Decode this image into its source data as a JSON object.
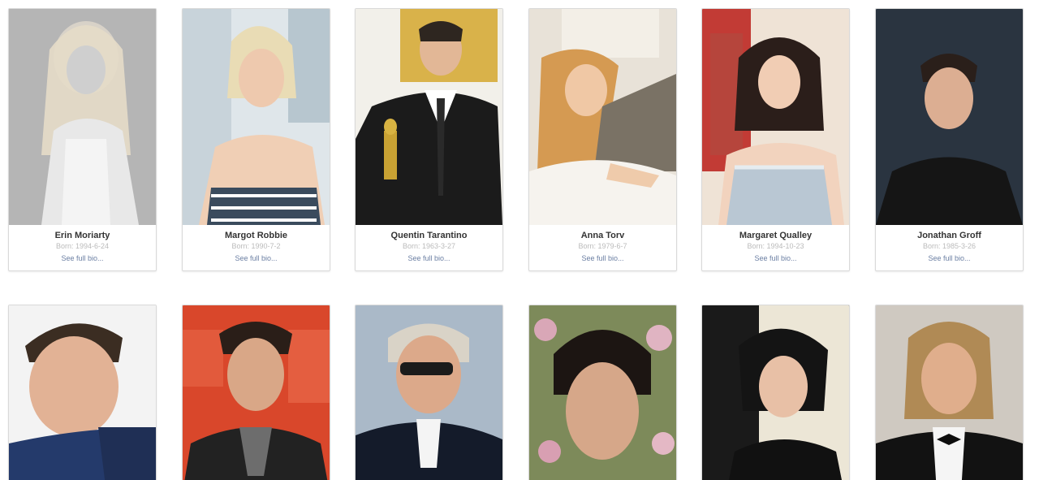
{
  "cards": [
    {
      "name": "Erin Moriarty",
      "born": "Born: 1994-6-24",
      "bio_link": "See full bio...",
      "photo": "portrait-bw-blonde-woman"
    },
    {
      "name": "Margot Robbie",
      "born": "Born: 1990-7-2",
      "bio_link": "See full bio...",
      "photo": "portrait-blonde-woman-striped-top"
    },
    {
      "name": "Quentin Tarantino",
      "born": "Born: 1963-3-27",
      "bio_link": "See full bio...",
      "photo": "portrait-man-tuxedo-oscar"
    },
    {
      "name": "Anna Torv",
      "born": "Born: 1979-6-7",
      "bio_link": "See full bio...",
      "photo": "portrait-woman-reclining-fur"
    },
    {
      "name": "Margaret Qualley",
      "born": "Born: 1994-10-23",
      "bio_link": "See full bio...",
      "photo": "portrait-brunette-woman-sequin-dress"
    },
    {
      "name": "Jonathan Groff",
      "born": "Born: 1985-3-26",
      "bio_link": "See full bio...",
      "photo": "portrait-man-dark-sweater"
    },
    {
      "photo": "portrait-man-blue-suit"
    },
    {
      "photo": "portrait-man-sundance-backdrop"
    },
    {
      "photo": "portrait-man-sunglasses-tuxedo"
    },
    {
      "photo": "portrait-man-floral-background"
    },
    {
      "photo": "portrait-woman-black-dress-event"
    },
    {
      "photo": "portrait-man-bowtie-tuxedo"
    }
  ],
  "colors": {
    "name": "#333333",
    "born": "#bbbbbb",
    "link": "#6b7fa3",
    "card_border": "#d9d9d9"
  }
}
